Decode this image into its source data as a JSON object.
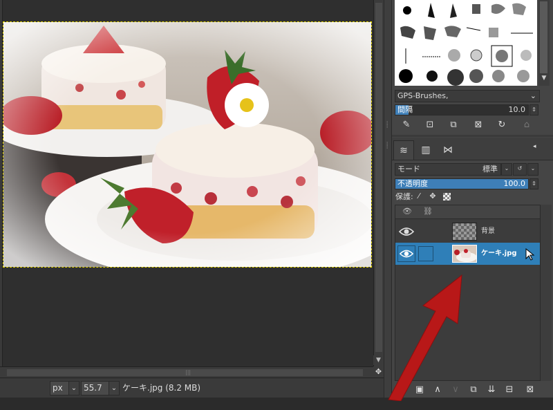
{
  "status": {
    "unit": "px",
    "zoom": "55.7 %",
    "file_info": "ケーキ.jpg (8.2 MB)"
  },
  "brushes": {
    "set_name": "GPS-Brushes,",
    "spacing_label": "間隔",
    "spacing_value": "10.0",
    "spacing_fraction": 0.1
  },
  "layers_panel": {
    "mode_label": "モード",
    "mode_value": "標準",
    "opacity_label": "不透明度",
    "opacity_value": "100.0",
    "opacity_fraction": 1.0,
    "lock_label": "保護:",
    "layers": [
      {
        "name": "背景",
        "visible": true,
        "selected": false
      },
      {
        "name": "ケーキ.jpg",
        "visible": true,
        "selected": true
      }
    ]
  },
  "colors": {
    "selection": "#2f7fb8",
    "slider_fill": "#3e7fb8",
    "arrow": "#b81818"
  }
}
